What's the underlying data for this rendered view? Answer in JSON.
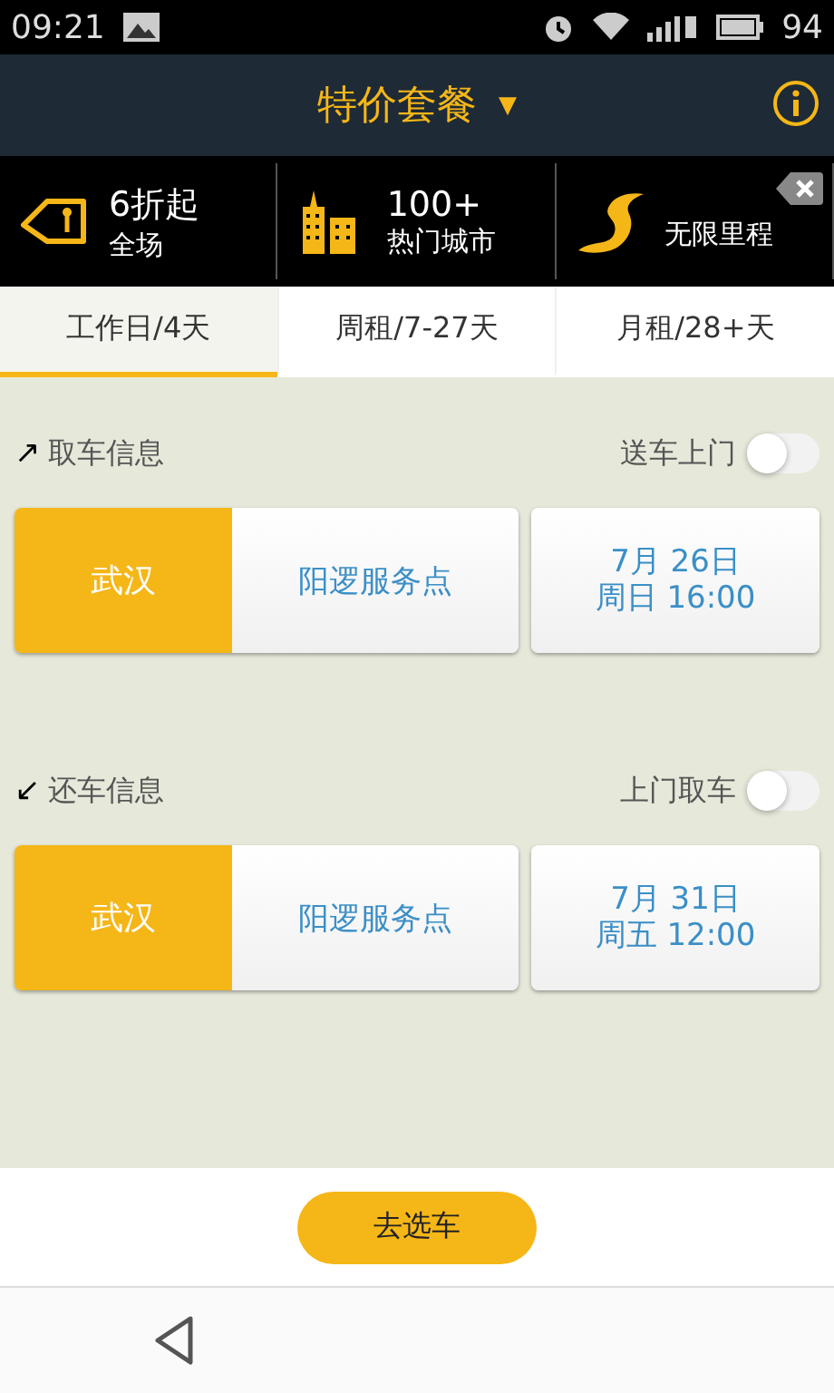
{
  "status_bar": {
    "time": "09:21",
    "battery": "94"
  },
  "header": {
    "title": "特价套餐",
    "caret": "▼"
  },
  "promos": [
    {
      "kind": "tag",
      "headline": "6折起",
      "caption": "全场"
    },
    {
      "kind": "buildings",
      "headline": "100+",
      "caption": "热门城市"
    },
    {
      "kind": "road",
      "caption": "无限里程"
    }
  ],
  "tabs": [
    {
      "label": "工作日/4天",
      "selected": true
    },
    {
      "label": "周租/7-27天",
      "selected": false
    },
    {
      "label": "月租/28+天",
      "selected": false
    }
  ],
  "sections": [
    {
      "arrow": "↗",
      "title": "取车信息",
      "toggle_label": "送车上门",
      "on": false,
      "city": "武汉",
      "store": "阳逻服务点",
      "date": "7月  26日",
      "time": "周日 16:00"
    },
    {
      "arrow": "↙",
      "title": "还车信息",
      "toggle_label": "上门取车",
      "on": false,
      "city": "武汉",
      "store": "阳逻服务点",
      "date": "7月  31日",
      "time": "周五 12:00"
    }
  ],
  "action_button": "去选车"
}
